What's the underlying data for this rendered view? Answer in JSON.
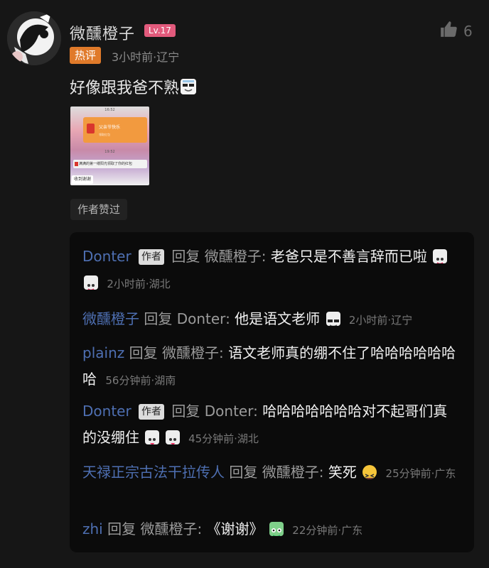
{
  "comment": {
    "username": "微醺橙子",
    "level": "Lv.17",
    "like_count": "6",
    "hot_badge": "热评",
    "meta": "3小时前·辽宁",
    "content": "好像跟我爸不熟",
    "author_liked": "作者赞过",
    "image": {
      "time1": "16:52",
      "card_title": "父亲节快乐",
      "card_sub": "领取红包",
      "time2": "19:52",
      "message": "满满的第一缕阳光领取了你的红包",
      "reply": "收到谢谢"
    }
  },
  "replies": [
    {
      "name": "Donter",
      "tag": "作者",
      "reply_word": "回复",
      "target": "微醺橙子",
      "text": "老爸只是不善言辞而已啦",
      "meta": "2小时前·湖北"
    },
    {
      "name": "微醺橙子",
      "tag": "",
      "reply_word": "回复",
      "target": "Donter",
      "text": "他是语文老师",
      "meta": "2小时前·辽宁"
    },
    {
      "name": "plainz",
      "tag": "",
      "reply_word": "回复",
      "target": "微醺橙子",
      "text": "语文老师真的绷不住了哈哈哈哈哈哈哈",
      "meta": "56分钟前·湖南"
    },
    {
      "name": "Donter",
      "tag": "作者",
      "reply_word": "回复",
      "target": "Donter",
      "text": "哈哈哈哈哈哈哈对不起哥们真的没绷住",
      "meta": "45分钟前·湖北"
    },
    {
      "name": "天禄正宗古法干拉传人",
      "tag": "",
      "reply_word": "回复",
      "target": "微醺橙子",
      "text": "笑死",
      "meta": "25分钟前·广东"
    },
    {
      "name": "zhi",
      "tag": "",
      "reply_word": "回复",
      "target": "微醺橙子",
      "text": "《谢谢》",
      "meta": "22分钟前·广东"
    }
  ]
}
